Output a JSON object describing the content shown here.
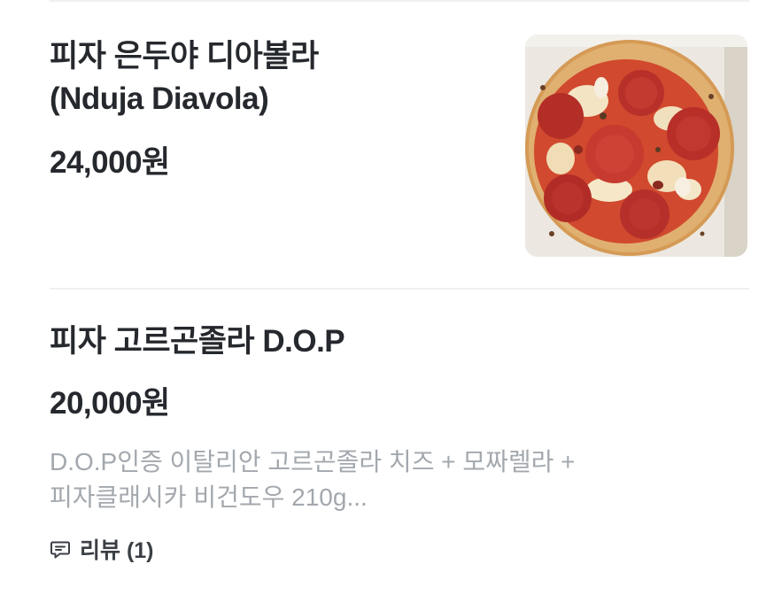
{
  "menu": {
    "items": [
      {
        "name": "피자 은두야 디아볼라\n(Nduja Diavola)",
        "price": "24,000원",
        "image": "pepperoni-pizza-photo"
      },
      {
        "name": "피자 고르곤졸라 D.O.P",
        "price": "20,000원",
        "description": "D.O.P인증 이탈리안 고르곤졸라 치즈 + 모짜렐라 +\n피자클래시카 비건도우 210g...",
        "review_label": "리뷰 (1)",
        "review_icon": "comment-icon"
      }
    ]
  },
  "colors": {
    "title_text": "#25282d",
    "description_text": "#a3a8ae",
    "divider": "#eef0f2",
    "pepperoni": "#c0392b",
    "crust": "#d8a15a"
  }
}
